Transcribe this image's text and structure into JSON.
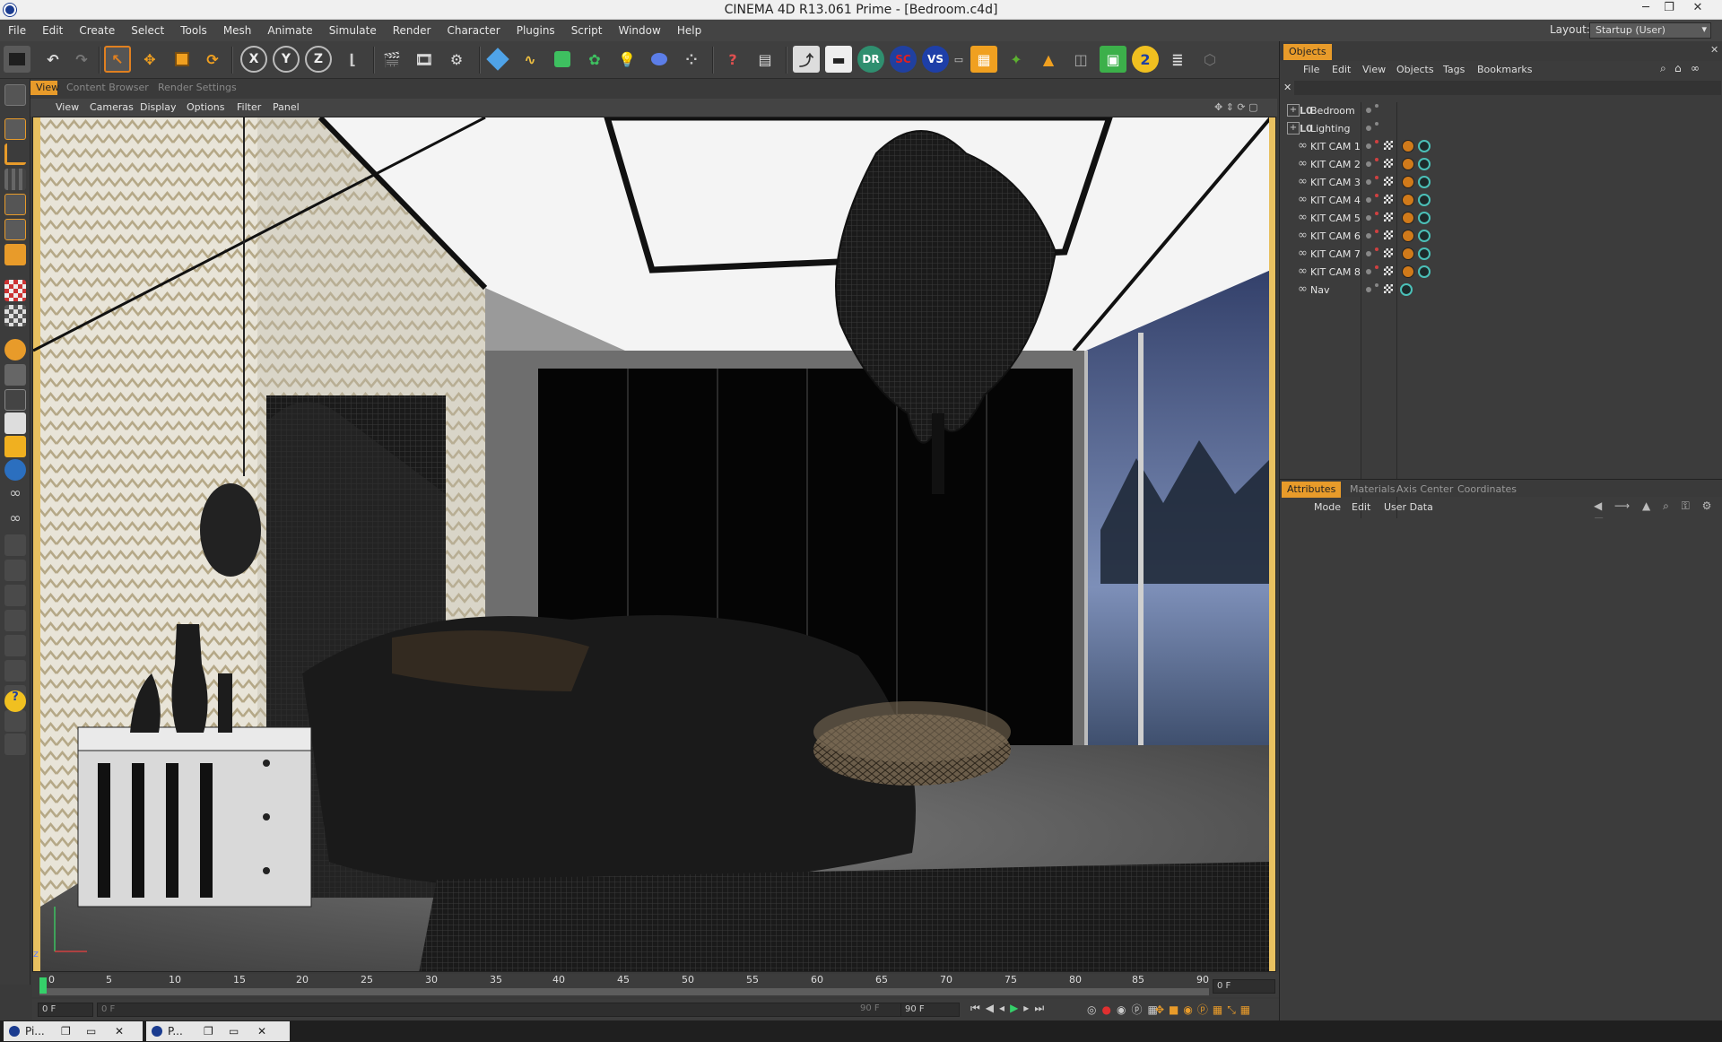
{
  "window": {
    "title": "CINEMA 4D R13.061 Prime - [Bedroom.c4d]"
  },
  "menu": [
    "File",
    "Edit",
    "Create",
    "Select",
    "Tools",
    "Mesh",
    "Animate",
    "Simulate",
    "Render",
    "Character",
    "Plugins",
    "Script",
    "Window",
    "Help"
  ],
  "layout": {
    "label": "Layout:",
    "value": "Startup (User)"
  },
  "view_tabs": [
    "View",
    "Content Browser",
    "Render Settings"
  ],
  "view_menu": [
    "View",
    "Cameras",
    "Display",
    "Options",
    "Filter",
    "Panel"
  ],
  "toolbar_icons": [
    "undo-icon",
    "redo-icon",
    "select-icon",
    "move-icon",
    "scale-icon",
    "rotate-icon",
    "x-axis-icon",
    "y-axis-icon",
    "z-axis-icon",
    "coord-system-icon",
    "render-view-icon",
    "render-picture-viewer-icon",
    "render-settings-icon",
    "cube-icon",
    "spline-icon",
    "nurbs-icon",
    "array-icon",
    "light-icon",
    "deformer-icon",
    "particles-icon",
    "help-icon",
    "material-icon",
    "plugin-1-icon",
    "plugin-2-icon",
    "dr-icon",
    "sc-icon",
    "vs-icon",
    "plugin-3-icon",
    "plugin-4-icon",
    "plugin-5-icon",
    "plugin-6-icon",
    "plugin-7-icon",
    "plugin-8-icon",
    "plugin-9-icon",
    "plugin-10-icon",
    "plugin-11-icon"
  ],
  "objects_panel": {
    "tab": "Objects",
    "menu": [
      "File",
      "Edit",
      "View",
      "Objects",
      "Tags",
      "Bookmarks"
    ],
    "items": [
      {
        "name": "Bedroom",
        "type": "group"
      },
      {
        "name": "Lighting",
        "type": "group"
      },
      {
        "name": "KIT CAM 1",
        "type": "camera"
      },
      {
        "name": "KIT CAM 2",
        "type": "camera"
      },
      {
        "name": "KIT CAM 3",
        "type": "camera"
      },
      {
        "name": "KIT CAM 4",
        "type": "camera"
      },
      {
        "name": "KIT CAM 5",
        "type": "camera"
      },
      {
        "name": "KIT CAM 6",
        "type": "camera"
      },
      {
        "name": "KIT CAM 7",
        "type": "camera"
      },
      {
        "name": "KIT CAM 8",
        "type": "camera"
      },
      {
        "name": "Nav",
        "type": "camera"
      }
    ]
  },
  "attributes_panel": {
    "tabs": [
      "Attributes",
      "Materials",
      "Axis Center",
      "Coordinates"
    ],
    "menu": [
      "Mode",
      "Edit",
      "User Data"
    ]
  },
  "timeline": {
    "ticks": [
      "0",
      "5",
      "10",
      "15",
      "20",
      "25",
      "30",
      "35",
      "40",
      "45",
      "50",
      "55",
      "60",
      "65",
      "70",
      "75",
      "80",
      "85",
      "90"
    ],
    "current_frame": "0 F"
  },
  "playbar": {
    "start": "0 F",
    "min": "0 F",
    "max": "90 F",
    "end": "90 F"
  },
  "taskbar": [
    {
      "label": "Pi..."
    },
    {
      "label": "P..."
    }
  ],
  "colors": {
    "accent": "#e89b2a",
    "panel": "#3c3c3c",
    "menubar": "#444444"
  }
}
